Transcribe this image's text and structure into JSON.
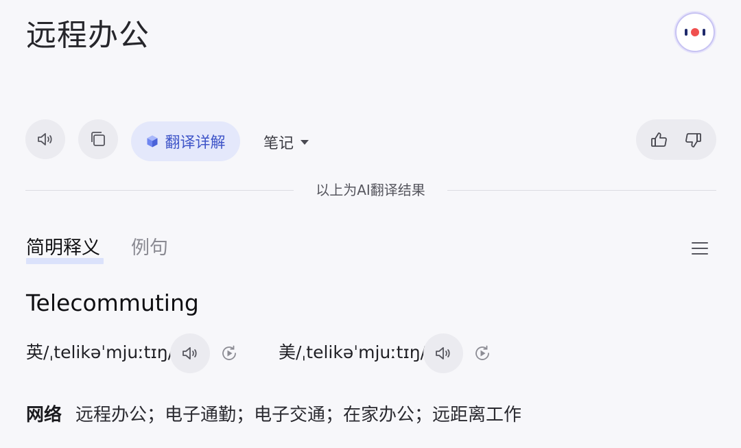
{
  "source": {
    "text": "远程办公"
  },
  "toolbar": {
    "detail_label": "翻译详解",
    "notes_label": "笔记"
  },
  "divider": {
    "text": "以上为AI翻译结果"
  },
  "tabs": [
    {
      "label": "简明释义",
      "active": true
    },
    {
      "label": "例句",
      "active": false
    }
  ],
  "entry": {
    "headword": "Telecommuting",
    "phonetics": {
      "uk": "英/ˌtelikəˈmjuːtɪŋ/",
      "us": "美/ˌtelikəˈmjuːtɪŋ/"
    },
    "definitions": [
      {
        "label": "网络",
        "text": "远程办公；电子通勤；电子交通；在家办公；远距离工作"
      }
    ]
  },
  "icons": {
    "avatar": "assistant-bot-icon",
    "speak": "speaker-icon",
    "copy": "copy-icon",
    "detail": "cube-icon",
    "thumbs_up": "thumbs-up-icon",
    "thumbs_down": "thumbs-down-icon",
    "menu": "hamburger-icon",
    "replay": "replay-icon"
  },
  "colors": {
    "accent": "#3f55c8",
    "accent_bg": "#e4e8fb",
    "avatar_red": "#f0504f",
    "avatar_navy": "#1f2a6b"
  }
}
